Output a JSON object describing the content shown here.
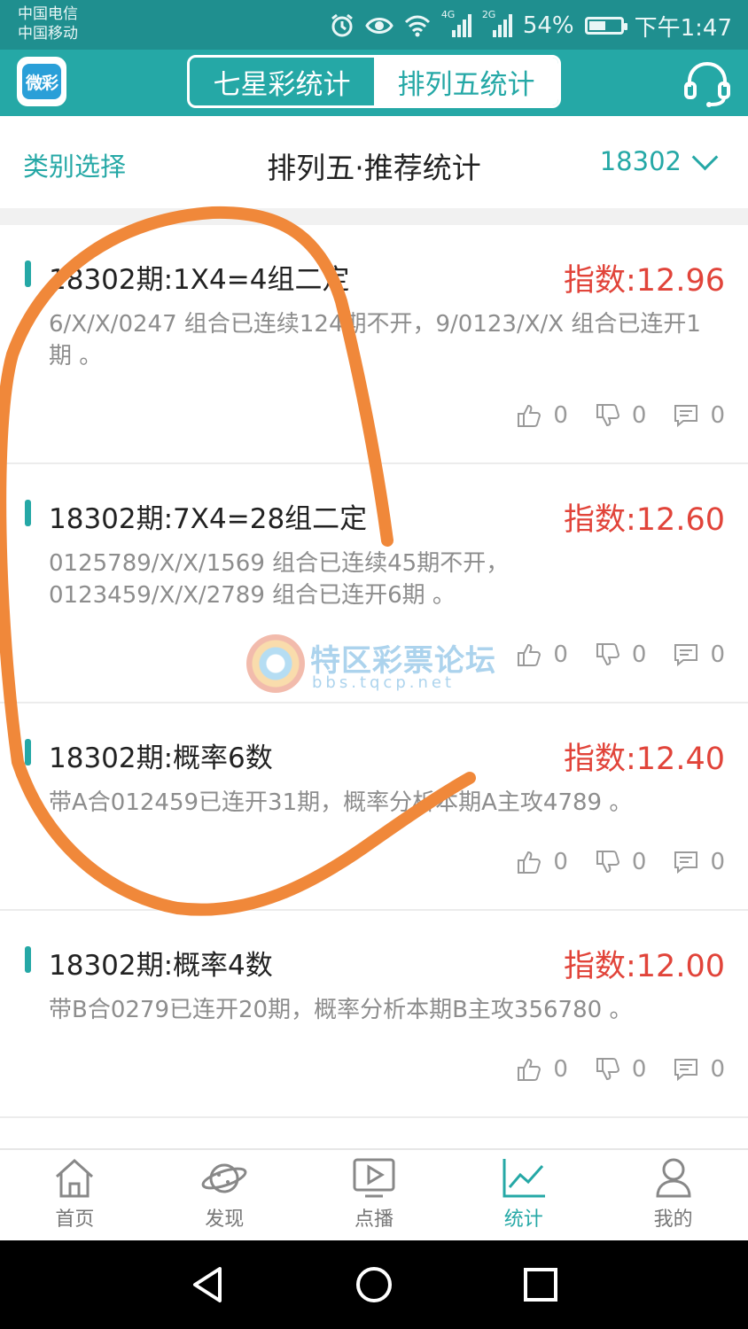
{
  "status_bar": {
    "carrier_1": "中国电信",
    "carrier_2": "中国移动",
    "network_4g": "4G",
    "network_2g": "2G",
    "battery": "54%",
    "battery_level": 0.54,
    "time": "下午1:47",
    "icons": [
      "alarm-icon",
      "eye-icon",
      "wifi-icon",
      "signal-icon",
      "battery-icon"
    ]
  },
  "app_bar": {
    "logo_text": "微彩",
    "tabs": [
      {
        "label": "七星彩统计",
        "active": false
      },
      {
        "label": "排列五统计",
        "active": true
      }
    ],
    "support_icon": "headset-icon"
  },
  "title_row": {
    "category_select": "类别选择",
    "title": "排列五·推荐统计",
    "issue": "18302"
  },
  "cards": [
    {
      "title": "18302期:1X4=4组二定",
      "index": "指数:12.96",
      "desc": "6/X/X/0247 组合已连续124期不开，9/0123/X/X 组合已连开1期 。",
      "likes": "0",
      "dislikes": "0",
      "comments": "0"
    },
    {
      "title": "18302期:7X4=28组二定",
      "index": "指数:12.60",
      "desc": "0125789/X/X/1569 组合已连续45期不开，0123459/X/X/2789 组合已连开6期 。",
      "likes": "0",
      "dislikes": "0",
      "comments": "0"
    },
    {
      "title": "18302期:概率6数",
      "index": "指数:12.40",
      "desc": "带A合012459已连开31期，概率分析本期A主攻4789 。",
      "likes": "0",
      "dislikes": "0",
      "comments": "0"
    },
    {
      "title": "18302期:概率4数",
      "index": "指数:12.00",
      "desc": "带B合0279已连开20期，概率分析本期B主攻356780 。",
      "likes": "0",
      "dislikes": "0",
      "comments": "0"
    }
  ],
  "watermark": {
    "name": "特区彩票论坛",
    "url": "bbs.tqcp.net"
  },
  "tab_bar": [
    {
      "label": "首页",
      "icon": "home-icon",
      "active": false
    },
    {
      "label": "发现",
      "icon": "planet-icon",
      "active": false
    },
    {
      "label": "点播",
      "icon": "play-icon",
      "active": false
    },
    {
      "label": "统计",
      "icon": "chart-icon",
      "active": true
    },
    {
      "label": "我的",
      "icon": "user-icon",
      "active": false
    }
  ],
  "colors": {
    "status_bar": "#1f8f8f",
    "accent": "#25a8a6",
    "index_red": "#e1443a",
    "annotation_orange": "#f0883a"
  }
}
